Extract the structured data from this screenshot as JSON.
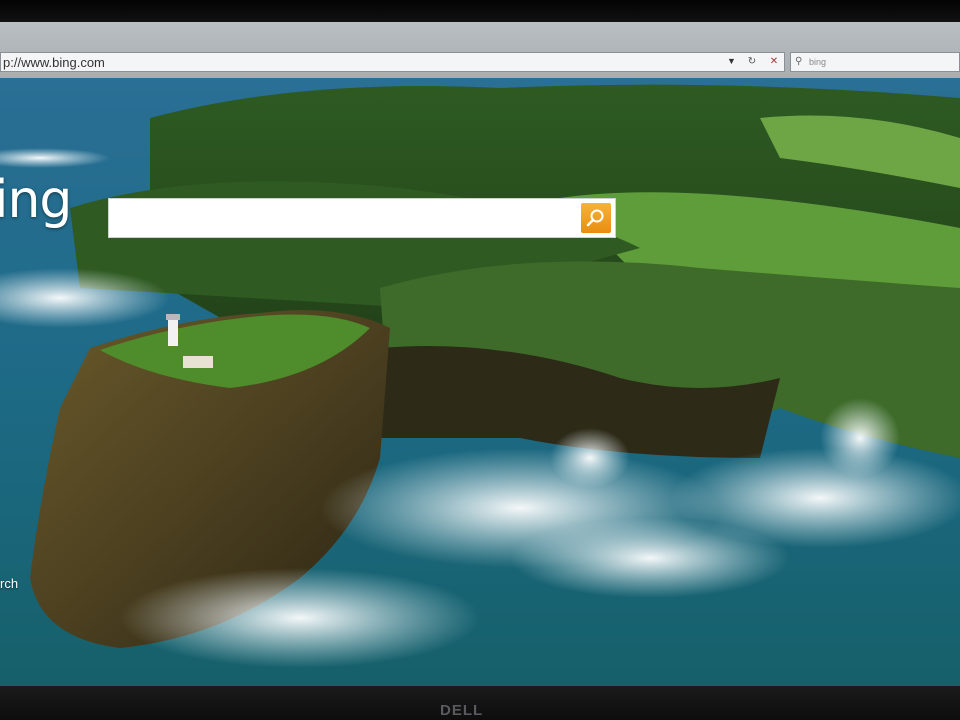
{
  "browser": {
    "address": "p://www.bing.com",
    "dropdown_glyph": "▼",
    "refresh_glyph": "↻",
    "stop_glyph": "✕",
    "search_placeholder": "bing",
    "search_icon": "search-icon"
  },
  "page": {
    "logo_text": "ing",
    "query_value": "",
    "go_button_icon": "search-icon",
    "side_link": "rch"
  },
  "monitor": {
    "logo_text": "DELL"
  },
  "colors": {
    "accent_orange": "#f0a020",
    "sea": "#1f6f86",
    "cliff_green": "#4d8a2e"
  }
}
